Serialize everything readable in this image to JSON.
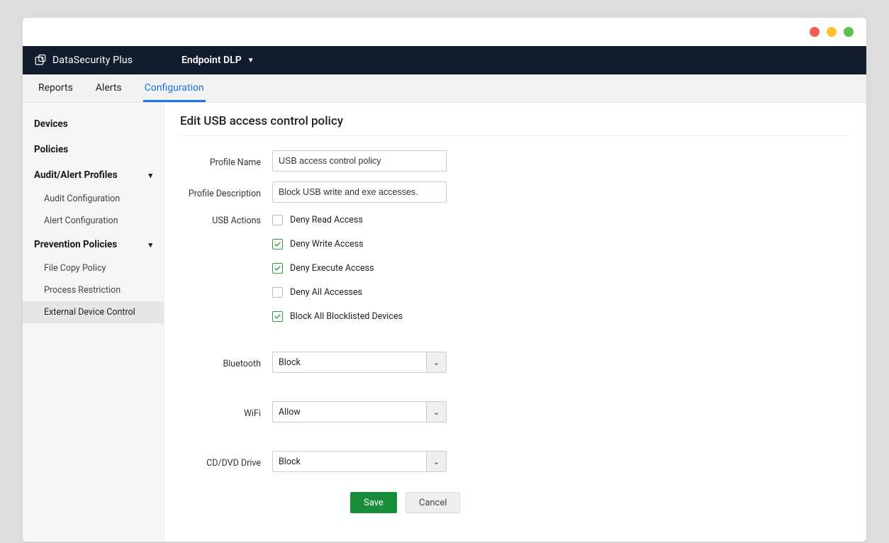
{
  "brand": "DataSecurity Plus",
  "module": "Endpoint DLP",
  "subnav": {
    "reports": "Reports",
    "alerts": "Alerts",
    "configuration": "Configuration"
  },
  "sidebar": {
    "devices": "Devices",
    "policies": "Policies",
    "audit_header": "Audit/Alert Profiles",
    "audit_items": {
      "audit_config": "Audit Configuration",
      "alert_config": "Alert Configuration"
    },
    "prevention_header": "Prevention Policies",
    "prevention_items": {
      "file_copy": "File Copy Policy",
      "process_restriction": "Process Restriction",
      "external_device": "External Device Control"
    }
  },
  "page": {
    "title": "Edit USB access control policy",
    "labels": {
      "profile_name": "Profile Name",
      "profile_description": "Profile Description",
      "usb_actions": "USB Actions",
      "bluetooth": "Bluetooth",
      "wifi": "WiFi",
      "cddvd": "CD/DVD Drive"
    },
    "values": {
      "profile_name": "USB access control policy",
      "profile_description": "Block USB write and exe accesses.",
      "bluetooth": "Block",
      "wifi": "Allow",
      "cddvd": "Block"
    },
    "usb_actions": [
      {
        "label": "Deny Read Access",
        "checked": false
      },
      {
        "label": "Deny Write Access",
        "checked": true
      },
      {
        "label": "Deny Execute Access",
        "checked": true
      },
      {
        "label": "Deny All Accesses",
        "checked": false
      },
      {
        "label": "Block All Blocklisted Devices",
        "checked": true
      }
    ],
    "buttons": {
      "save": "Save",
      "cancel": "Cancel"
    }
  }
}
